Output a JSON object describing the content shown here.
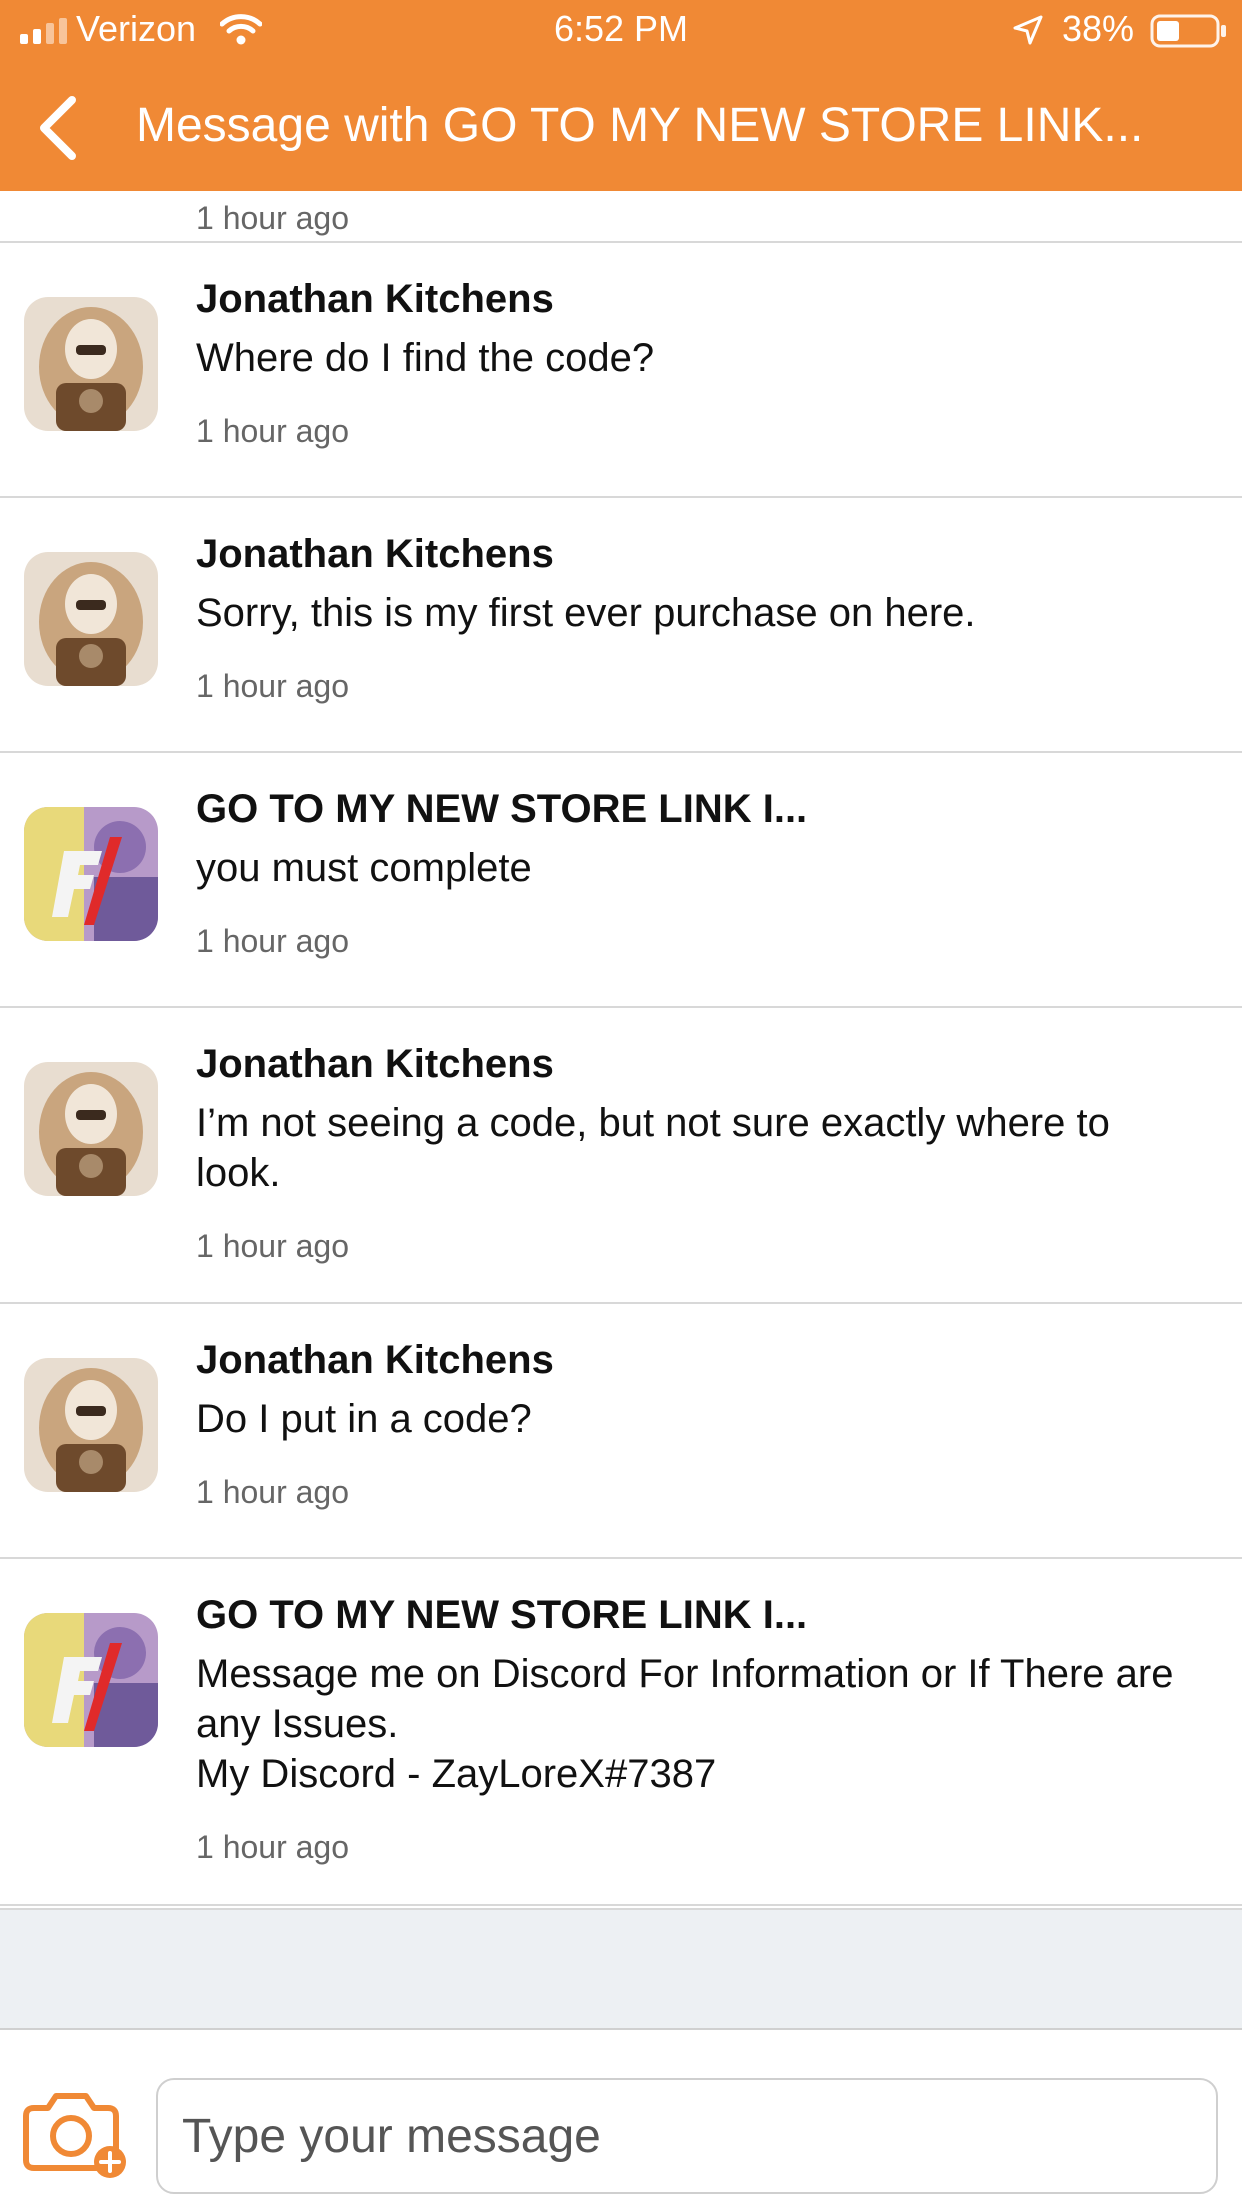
{
  "status": {
    "carrier": "Verizon",
    "time": "6:52 PM",
    "battery": "38%",
    "icons": [
      "signal-icon",
      "wifi-icon",
      "location-arrow-icon",
      "battery-icon"
    ]
  },
  "nav": {
    "title": "Message with GO TO MY NEW STORE LINK...",
    "back_icon": "chevron-left-icon"
  },
  "colors": {
    "accent": "#f08935",
    "divider": "#d8d8d8",
    "timestamp": "#666666",
    "footer_bg": "#edf0f3"
  },
  "partial_message": {
    "time": "1 hour ago"
  },
  "messages": [
    {
      "sender": "Jonathan Kitchens",
      "text": "Where do I find the code?",
      "time": "1 hour ago",
      "avatar": "user-avatar"
    },
    {
      "sender": "Jonathan Kitchens",
      "text": "Sorry, this is my first ever purchase on here.",
      "time": "1 hour ago",
      "avatar": "user-avatar"
    },
    {
      "sender": "GO TO MY NEW STORE LINK I...",
      "text": "you must complete",
      "time": "1 hour ago",
      "avatar": "store-avatar"
    },
    {
      "sender": "Jonathan Kitchens",
      "text": "I’m not seeing a code, but not sure exactly where to look.",
      "time": "1 hour ago",
      "avatar": "user-avatar"
    },
    {
      "sender": "Jonathan Kitchens",
      "text": "Do I put in a code?",
      "time": "1 hour ago",
      "avatar": "user-avatar"
    },
    {
      "sender": "GO TO MY NEW STORE LINK I...",
      "text": "Message me on Discord For Information or If There are any Issues.\nMy Discord - ZayLoreX#7387",
      "time": "1 hour ago",
      "avatar": "store-avatar"
    }
  ],
  "composer": {
    "placeholder": "Type your message",
    "camera_icon": "camera-add-icon"
  }
}
